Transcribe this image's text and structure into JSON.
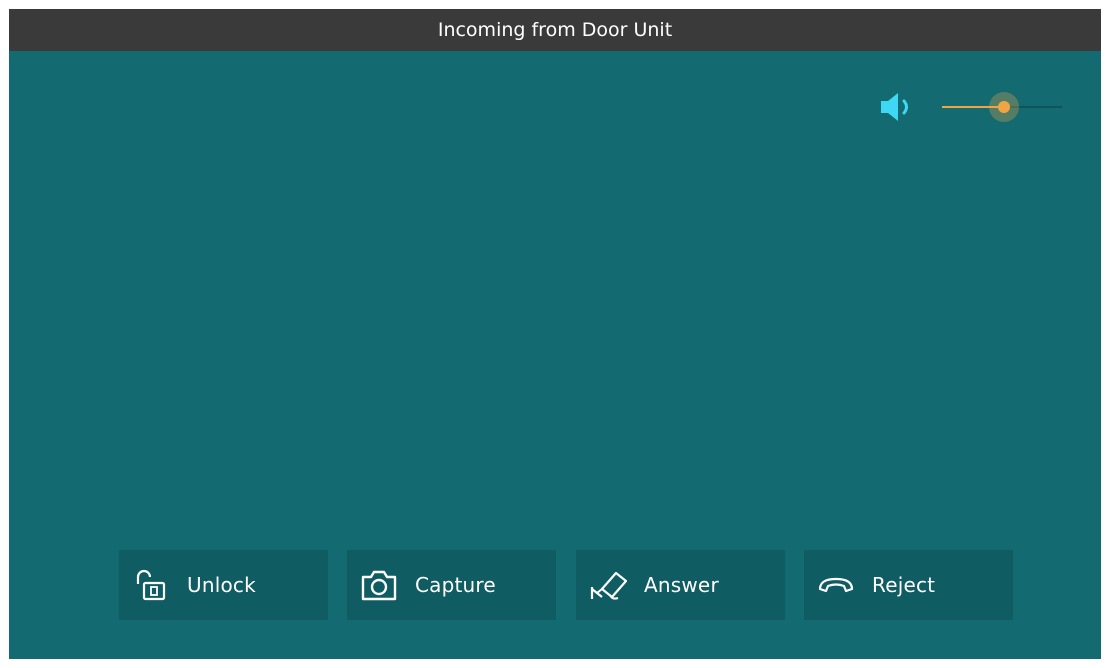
{
  "window": {
    "title": "Incoming from Door Unit"
  },
  "volume": {
    "icon": "speaker-icon",
    "level_fraction": 0.52,
    "accent_color": "#f0a544",
    "icon_color": "#3fd8f4"
  },
  "actions": [
    {
      "id": "unlock",
      "label": "Unlock",
      "icon": "unlock-icon"
    },
    {
      "id": "capture",
      "label": "Capture",
      "icon": "camera-icon"
    },
    {
      "id": "answer",
      "label": "Answer",
      "icon": "cctv-camera-icon"
    },
    {
      "id": "reject",
      "label": "Reject",
      "icon": "hang-up-icon"
    }
  ],
  "colors": {
    "background": "#136a71",
    "title_bar": "#3a3a3a",
    "button": "#0f5c62",
    "text": "#ffffff"
  }
}
